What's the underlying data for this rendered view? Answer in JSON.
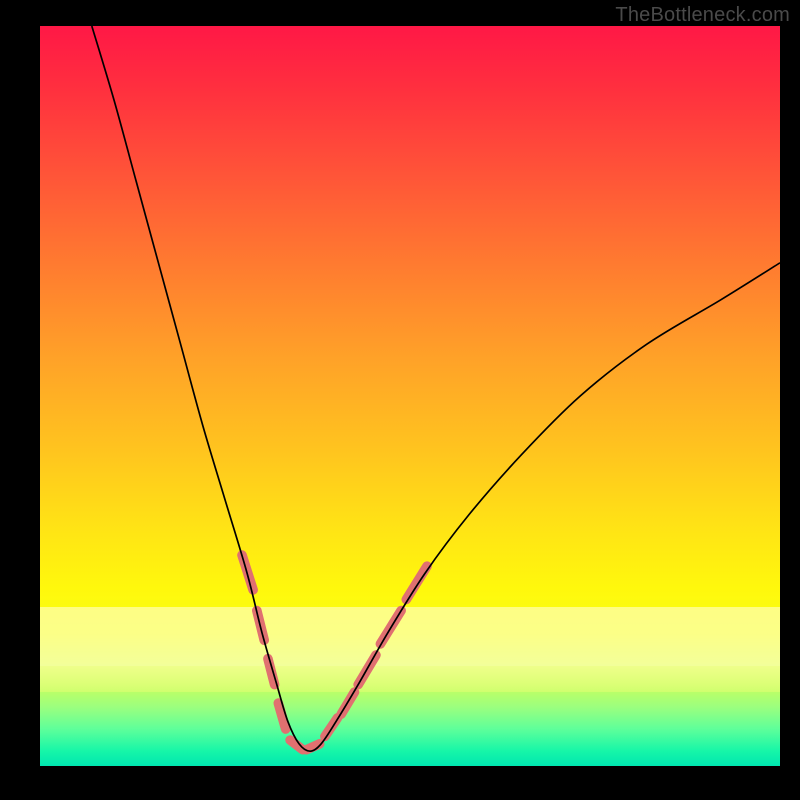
{
  "watermark": "TheBottleneck.com",
  "chart_data": {
    "type": "line",
    "title": "",
    "xlabel": "",
    "ylabel": "",
    "xlim": [
      0,
      100
    ],
    "ylim": [
      0,
      100
    ],
    "grid": false,
    "legend": false,
    "series": [
      {
        "name": "bottleneck-curve",
        "x": [
          7,
          10,
          13,
          16,
          19,
          22,
          25,
          28,
          30,
          32,
          33.5,
          35,
          36.5,
          38,
          40,
          43,
          47,
          52,
          58,
          65,
          73,
          82,
          92,
          100
        ],
        "y": [
          100,
          90,
          79,
          68,
          57,
          46,
          36,
          26,
          18,
          11,
          6,
          3,
          2,
          3,
          6,
          11,
          18,
          26,
          34,
          42,
          50,
          57,
          63,
          68
        ],
        "color": "#000000"
      },
      {
        "name": "highlight-dashes",
        "segments": [
          {
            "x1": 27.3,
            "y1": 28.5,
            "x2": 28.8,
            "y2": 23.8
          },
          {
            "x1": 29.3,
            "y1": 21.0,
            "x2": 30.3,
            "y2": 17.0
          },
          {
            "x1": 30.8,
            "y1": 14.5,
            "x2": 31.7,
            "y2": 11.0
          },
          {
            "x1": 32.2,
            "y1": 8.5,
            "x2": 33.2,
            "y2": 5.0
          },
          {
            "x1": 33.8,
            "y1": 3.5,
            "x2": 35.5,
            "y2": 2.2
          },
          {
            "x1": 36.0,
            "y1": 2.2,
            "x2": 37.8,
            "y2": 3.0
          },
          {
            "x1": 38.5,
            "y1": 4.0,
            "x2": 40.2,
            "y2": 6.5
          },
          {
            "x1": 40.7,
            "y1": 7.0,
            "x2": 42.5,
            "y2": 10.0
          },
          {
            "x1": 43.0,
            "y1": 11.0,
            "x2": 45.4,
            "y2": 15.0
          },
          {
            "x1": 46.0,
            "y1": 16.5,
            "x2": 48.8,
            "y2": 21.0
          },
          {
            "x1": 49.5,
            "y1": 22.5,
            "x2": 52.3,
            "y2": 27.0
          }
        ],
        "color": "#e07070",
        "width": 9
      }
    ],
    "background_gradient": {
      "direction": "vertical",
      "stops": [
        {
          "pos": 0.0,
          "color": "#ff1846"
        },
        {
          "pos": 0.45,
          "color": "#ffa228"
        },
        {
          "pos": 0.76,
          "color": "#fff80c"
        },
        {
          "pos": 1.0,
          "color": "#00e6b0"
        }
      ]
    }
  }
}
